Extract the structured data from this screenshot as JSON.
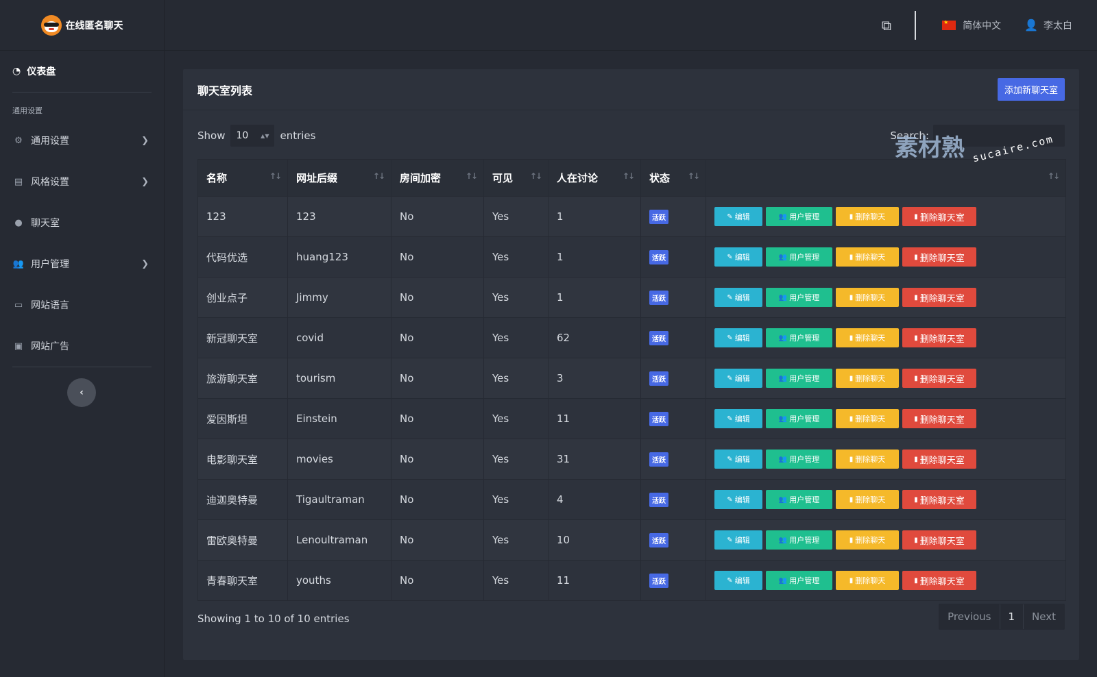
{
  "brand": {
    "title": "在线匿名聊天"
  },
  "topbar": {
    "language": "简体中文",
    "user": "李太白"
  },
  "sidebar": {
    "dashboard": "仪表盘",
    "heading": "通用设置",
    "items": [
      {
        "label": "通用设置",
        "icon": "gear-icon",
        "has_submenu": true
      },
      {
        "label": "风格设置",
        "icon": "brush-icon",
        "has_submenu": true
      },
      {
        "label": "聊天室",
        "icon": "chat-icon",
        "has_submenu": false
      },
      {
        "label": "用户管理",
        "icon": "users-icon",
        "has_submenu": true
      },
      {
        "label": "网站语言",
        "icon": "language-icon",
        "has_submenu": false
      },
      {
        "label": "网站广告",
        "icon": "ad-icon",
        "has_submenu": false
      }
    ]
  },
  "card": {
    "title": "聊天室列表",
    "add_button": "添加新聊天室"
  },
  "controls": {
    "show_label": "Show",
    "page_size": "10",
    "entries_label": "entries",
    "search_label": "Search:",
    "search_value": ""
  },
  "table": {
    "headers": [
      "名称",
      "网址后缀",
      "房间加密",
      "可见",
      "人在讨论",
      "状态",
      ""
    ],
    "rows": [
      {
        "name": "123",
        "slug": "123",
        "encrypted": "No",
        "visible": "Yes",
        "online": "1",
        "status": "活跃"
      },
      {
        "name": "代码优选",
        "slug": "huang123",
        "encrypted": "No",
        "visible": "Yes",
        "online": "1",
        "status": "活跃"
      },
      {
        "name": "创业点子",
        "slug": "Jimmy",
        "encrypted": "No",
        "visible": "Yes",
        "online": "1",
        "status": "活跃"
      },
      {
        "name": "新冠聊天室",
        "slug": "covid",
        "encrypted": "No",
        "visible": "Yes",
        "online": "62",
        "status": "活跃"
      },
      {
        "name": "旅游聊天室",
        "slug": "tourism",
        "encrypted": "No",
        "visible": "Yes",
        "online": "3",
        "status": "活跃"
      },
      {
        "name": "爱因斯坦",
        "slug": "Einstein",
        "encrypted": "No",
        "visible": "Yes",
        "online": "11",
        "status": "活跃"
      },
      {
        "name": "电影聊天室",
        "slug": "movies",
        "encrypted": "No",
        "visible": "Yes",
        "online": "31",
        "status": "活跃"
      },
      {
        "name": "迪迦奥特曼",
        "slug": "Tigaultraman",
        "encrypted": "No",
        "visible": "Yes",
        "online": "4",
        "status": "活跃"
      },
      {
        "name": "雷欧奥特曼",
        "slug": "Lenoultraman",
        "encrypted": "No",
        "visible": "Yes",
        "online": "10",
        "status": "活跃"
      },
      {
        "name": "青春聊天室",
        "slug": "youths",
        "encrypted": "No",
        "visible": "Yes",
        "online": "11",
        "status": "活跃"
      }
    ],
    "actions": {
      "edit": "编辑",
      "users": "用户管理",
      "clear": "删除聊天",
      "delete": "删除聊天室"
    }
  },
  "footer": {
    "info": "Showing 1 to 10 of 10 entries",
    "previous": "Previous",
    "page": "1",
    "next": "Next"
  },
  "watermark": {
    "main": "素材熟",
    "sub": "sucaire.com"
  },
  "colors": {
    "primary": "#4769e4",
    "info": "#2bb3d1",
    "success": "#1fbf8f",
    "warning": "#f5b92a",
    "danger": "#e04a3d",
    "background": "#262a33",
    "card": "#2d323c"
  }
}
